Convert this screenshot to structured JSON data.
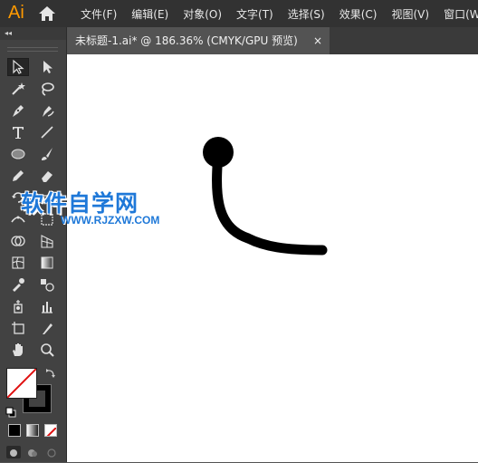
{
  "app": {
    "logo": "Ai"
  },
  "menu": [
    "文件(F)",
    "编辑(E)",
    "对象(O)",
    "文字(T)",
    "选择(S)",
    "效果(C)",
    "视图(V)",
    "窗口(W)"
  ],
  "tabs": [
    {
      "label": "未标题-1.ai* @ 186.36% (CMYK/GPU 预览)",
      "close": "×"
    }
  ],
  "toolbar": {
    "collapse": "◂◂"
  },
  "watermark": {
    "title": "软件自学网",
    "url": "WWW.RJZXW.COM"
  },
  "colors": {
    "fill": "none",
    "stroke": "#000000",
    "accent": "#ff9a00"
  },
  "tools": [
    "selection-tool",
    "direct-selection-tool",
    "magic-wand-tool",
    "lasso-tool",
    "pen-tool",
    "curvature-tool",
    "type-tool",
    "line-segment-tool",
    "ellipse-tool",
    "paintbrush-tool",
    "pencil-tool",
    "eraser-tool",
    "rotate-tool",
    "scale-tool",
    "width-tool",
    "free-transform-tool",
    "shape-builder-tool",
    "perspective-grid-tool",
    "mesh-tool",
    "gradient-tool",
    "eyedropper-tool",
    "blend-tool",
    "symbol-sprayer-tool",
    "column-graph-tool",
    "artboard-tool",
    "slice-tool",
    "hand-tool",
    "zoom-tool"
  ]
}
